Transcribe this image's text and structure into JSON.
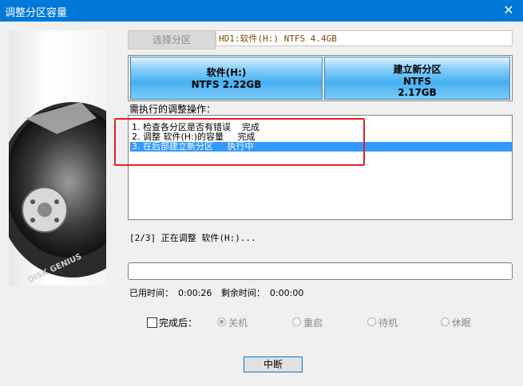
{
  "window": {
    "title": "调整分区容量"
  },
  "disk": {
    "select_label": "选择分区",
    "info": "HD1:软件(H:) NTFS 4.4GB"
  },
  "partitions": [
    {
      "name": "软件(H:)",
      "fs": "NTFS 2.22GB",
      "size": ""
    },
    {
      "name": "建立新分区",
      "fs": "NTFS",
      "size": "2.17GB"
    }
  ],
  "operations": {
    "label": "需执行的调整操作：",
    "items": [
      {
        "text": "1. 检查各分区是否有错误    完成",
        "selected": false
      },
      {
        "text": "2. 调整 软件(H:)的容量     完成",
        "selected": false
      },
      {
        "text": "3. 在后部建立新分区     执行中",
        "selected": true
      }
    ]
  },
  "status_text": "[2/3] 正在调整 软件(H:)...",
  "progress": 0.0,
  "times": {
    "elapsed_label": "已用时间：",
    "elapsed": "0:00:26",
    "remaining_label": "剩余时间：",
    "remaining": "0:00:00"
  },
  "after": {
    "checkbox_label": "完成后：",
    "options": [
      "关机",
      "重启",
      "待机",
      "休眠"
    ],
    "selected": "关机"
  },
  "buttons": {
    "abort": "中断"
  },
  "colors": {
    "titlebar": "#0078d7",
    "partition": "#46b0f2",
    "selection": "#3399ff",
    "highlight_box": "#e02020"
  }
}
